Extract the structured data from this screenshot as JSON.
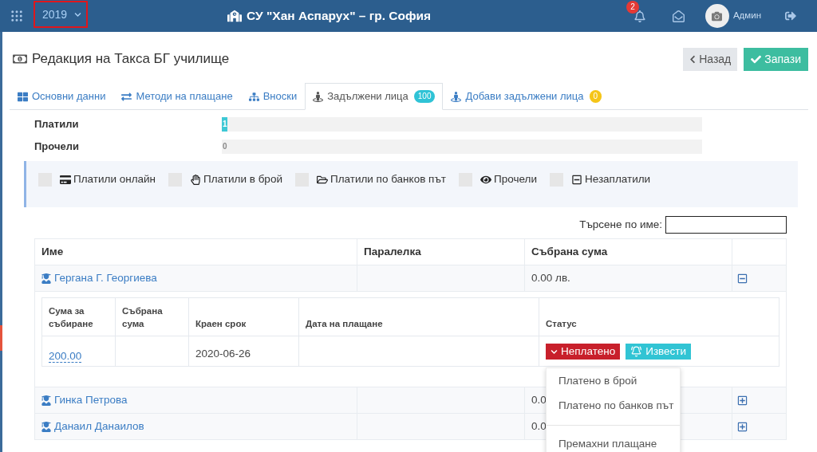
{
  "top_bar": {
    "year": {
      "label": "2019",
      "highlighted": true
    },
    "school": "СУ \"Хан Аспарух\" – гр. София",
    "notifications": "2",
    "user": "Админ"
  },
  "page": {
    "title": "Редакция на Такса БГ училище",
    "buttons": [
      {
        "kind": "back",
        "label": "Назад"
      },
      {
        "kind": "save",
        "label": "Запази"
      }
    ]
  },
  "tabs": [
    {
      "kind": "grid",
      "label": "Основни данни",
      "selected": false
    },
    {
      "kind": "exchange",
      "label": "Методи на плащане",
      "selected": false
    },
    {
      "kind": "sitemap",
      "label": "Вноски",
      "selected": false
    },
    {
      "kind": "person",
      "label": "Задължени лица",
      "selected": true,
      "badge": {
        "text": "100",
        "color": "#2fc3d6"
      }
    },
    {
      "kind": "person",
      "label": "Добави задължени лица",
      "selected": false,
      "badge": {
        "text": "0",
        "color": "#f5c518"
      }
    }
  ],
  "stats": [
    {
      "label": "Платили",
      "level": 0.012,
      "value": "1"
    },
    {
      "label": "Прочели",
      "value": "0"
    }
  ],
  "filters": [
    {
      "kind": "card",
      "label": "Платили онлайн",
      "checked": false
    },
    {
      "kind": "hand",
      "label": "Платили в брой",
      "checked": false
    },
    {
      "kind": "folder",
      "label": "Платили по банков път",
      "checked": false
    },
    {
      "kind": "eye",
      "label": "Прочели",
      "checked": false
    },
    {
      "kind": "minus",
      "label": "Незаплатили",
      "checked": false
    }
  ],
  "search": {
    "label": "Търсене по име:"
  },
  "table": {
    "columns": [
      "Име",
      "Паралелка",
      "Събрана сума"
    ],
    "rows": [
      {
        "name": "Гергана Г. Георгиева",
        "collected": "0.00 лв.",
        "expanded": true,
        "payments": {
          "columns": [
            "Сума за събиране",
            "Събрана сума",
            "Краен срок",
            "Дата на плащане",
            "Статус"
          ],
          "rows": [
            {
              "amount": "200.00",
              "due": "2020-06-26",
              "status": {
                "label": "Неплатено",
                "paid": false
              },
              "notify": "Извести",
              "menu": {
                "open": true,
                "items": [
                  {
                    "kind": "item",
                    "label": "Платено в брой"
                  },
                  {
                    "kind": "item",
                    "label": "Платено по банков път"
                  },
                  {
                    "kind": "divider"
                  },
                  {
                    "kind": "item",
                    "label": "Премахни плащане"
                  }
                ]
              }
            }
          ]
        }
      },
      {
        "name": "Гинка Петрова",
        "collected": "0.0",
        "expanded": false
      },
      {
        "name": "Данаил Данаилов",
        "collected": "0.0",
        "expanded": false
      }
    ]
  }
}
